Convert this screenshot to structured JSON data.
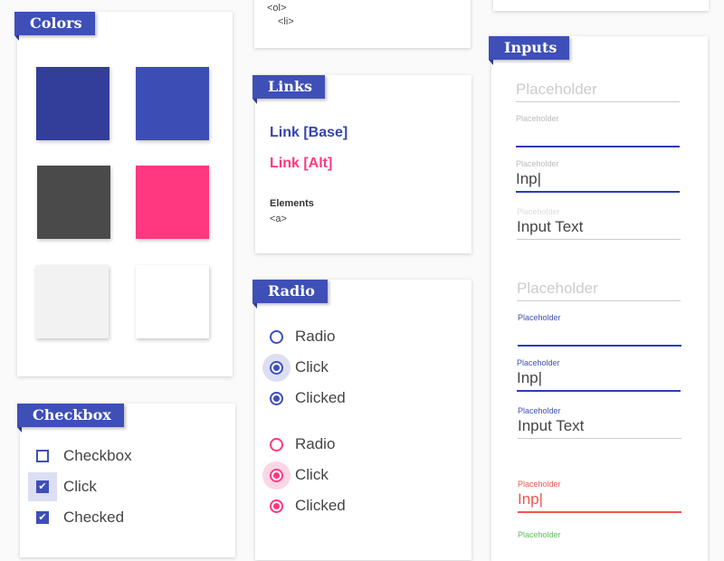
{
  "colors": {
    "title": "Colors",
    "swatches": [
      {
        "name": "primary-dark",
        "hex": "#323e9a"
      },
      {
        "name": "primary",
        "hex": "#3d4db6"
      },
      {
        "name": "dark-gray",
        "hex": "#4a4a4a"
      },
      {
        "name": "accent-pink",
        "hex": "#ff3880"
      },
      {
        "name": "light-gray",
        "hex": "#f2f2f2"
      },
      {
        "name": "white",
        "hex": "#ffffff"
      }
    ]
  },
  "lists": {
    "elements": [
      "<ol>",
      "<li>"
    ]
  },
  "links": {
    "title": "Links",
    "base_label": "Link [Base]",
    "alt_label": "Link [Alt]",
    "elements_label": "Elements",
    "elements": [
      "<a>"
    ],
    "base_color": "#3444b0",
    "alt_color": "#ff3880"
  },
  "radio": {
    "title": "Radio",
    "primary": [
      {
        "label": "Radio",
        "state": "unchecked"
      },
      {
        "label": "Click",
        "state": "pressed"
      },
      {
        "label": "Clicked",
        "state": "checked"
      }
    ],
    "accent": [
      {
        "label": "Radio",
        "state": "unchecked"
      },
      {
        "label": "Click",
        "state": "pressed"
      },
      {
        "label": "Clicked",
        "state": "checked"
      }
    ],
    "primary_color": "#3f4fb8",
    "accent_color": "#ff3880"
  },
  "checkbox": {
    "title": "Checkbox",
    "items": [
      {
        "label": "Checkbox",
        "state": "unchecked"
      },
      {
        "label": "Click",
        "state": "pressed"
      },
      {
        "label": "Checked",
        "state": "checked"
      }
    ],
    "check_glyph": "✔"
  },
  "inputs": {
    "title": "Inputs",
    "fields": [
      {
        "label": "",
        "placeholder": "Placeholder",
        "value": "",
        "state": "empty"
      },
      {
        "label": "Placeholder",
        "placeholder": "",
        "value": "",
        "state": "focused"
      },
      {
        "label": "Placeholder",
        "placeholder": "",
        "value": "Inp|",
        "state": "typing"
      },
      {
        "label": "Placeholder",
        "placeholder": "",
        "value": "Input Text",
        "state": "filled"
      },
      {
        "label": "",
        "placeholder": "Placeholder",
        "value": "",
        "state": "empty"
      },
      {
        "label": "Placeholder",
        "placeholder": "",
        "value": "",
        "state": "focused-colored"
      },
      {
        "label": "Placeholder",
        "placeholder": "",
        "value": "Inp|",
        "state": "typing-colored"
      },
      {
        "label": "Placeholder",
        "placeholder": "",
        "value": "Input Text",
        "state": "filled-colored"
      },
      {
        "label": "Placeholder",
        "placeholder": "",
        "value": "Inp|",
        "state": "error"
      },
      {
        "label": "Placeholder",
        "placeholder": "",
        "value": "",
        "state": "success"
      }
    ],
    "focus_color": "#2b3db8",
    "error_color": "#f2564f",
    "success_color": "#5fbf5f"
  }
}
